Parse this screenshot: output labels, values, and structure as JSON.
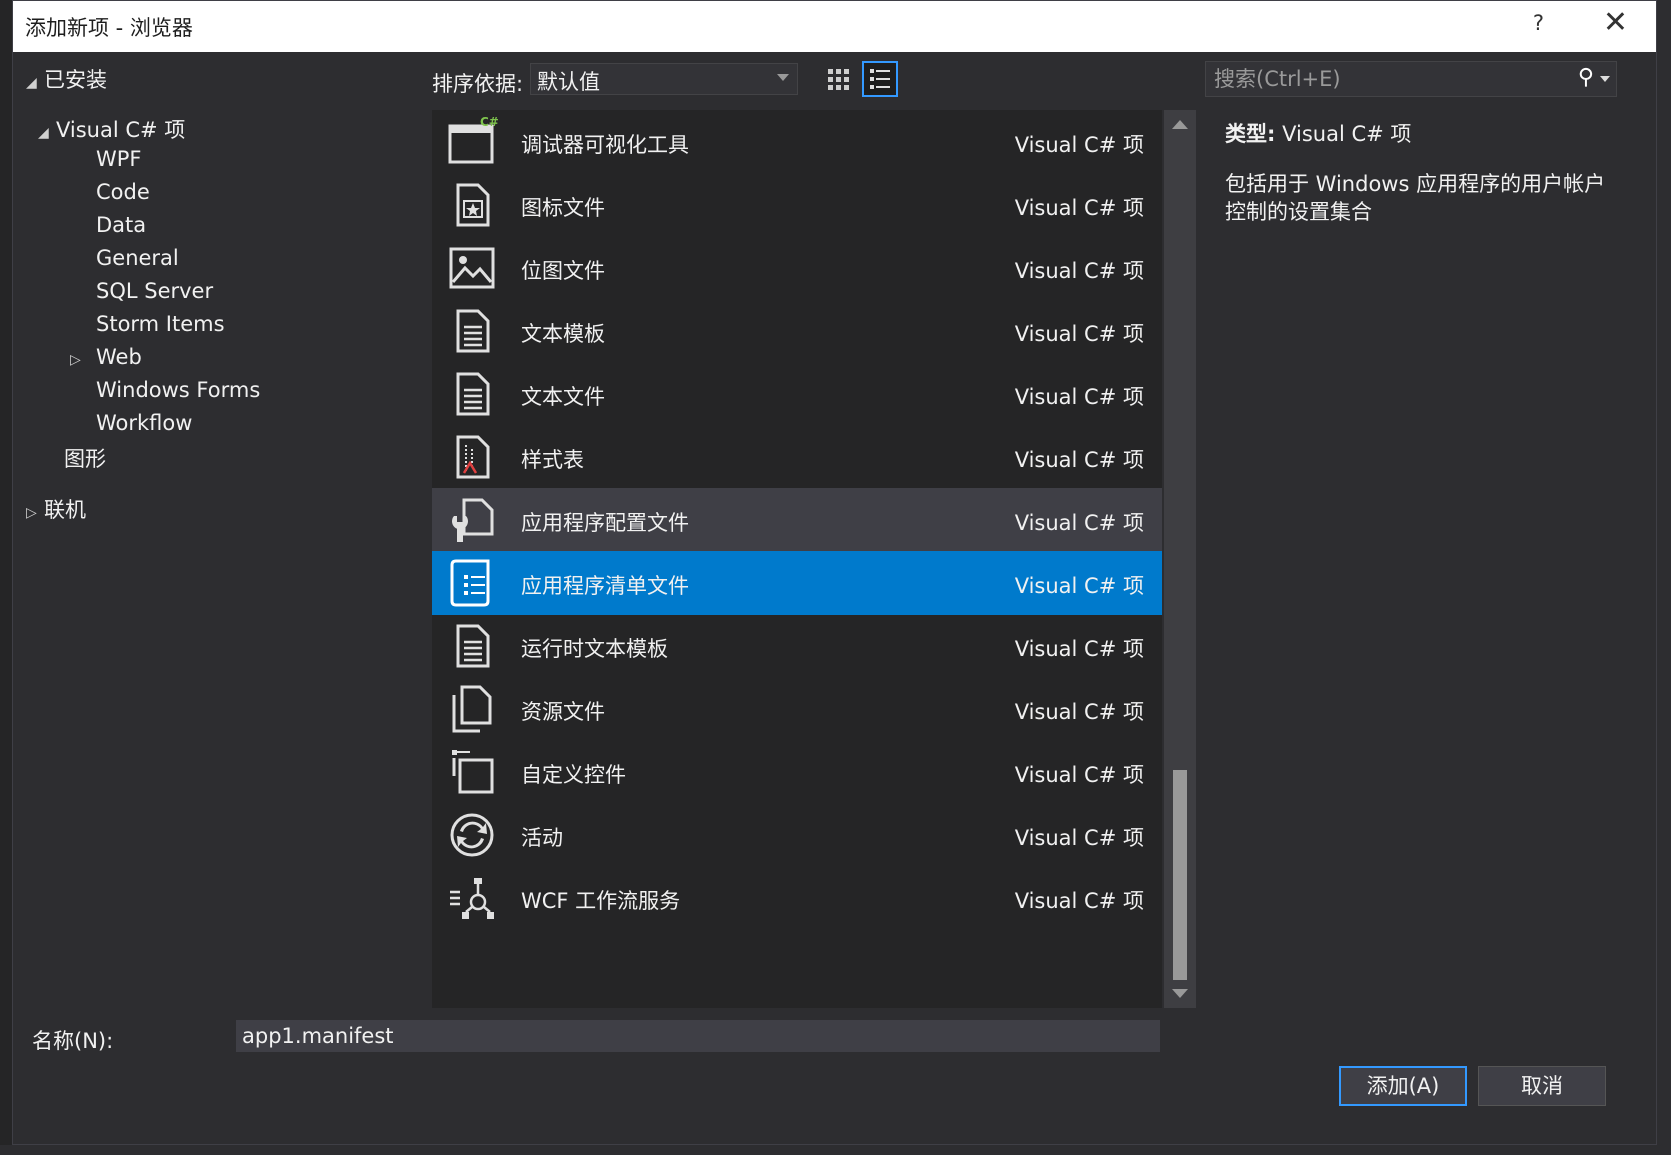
{
  "window": {
    "title": "添加新项 - 浏览器",
    "help": "?",
    "close": "✕"
  },
  "tree": {
    "installed": "已安装",
    "csharp": "Visual C# 项",
    "children": [
      "WPF",
      "Code",
      "Data",
      "General",
      "SQL Server",
      "Storm Items",
      "Web",
      "Windows Forms",
      "Workflow"
    ],
    "graphics": "图形",
    "online": "联机"
  },
  "toolbar": {
    "sort_label": "排序依据:",
    "sort_value": "默认值"
  },
  "search": {
    "placeholder": "搜索(Ctrl+E)"
  },
  "items": [
    {
      "name": "调试器可视化工具",
      "type": "Visual C# 项",
      "icon": "debugger-visualizer-icon"
    },
    {
      "name": "图标文件",
      "type": "Visual C# 项",
      "icon": "icon-file-icon"
    },
    {
      "name": "位图文件",
      "type": "Visual C# 项",
      "icon": "bitmap-icon"
    },
    {
      "name": "文本模板",
      "type": "Visual C# 项",
      "icon": "text-template-icon"
    },
    {
      "name": "文本文件",
      "type": "Visual C# 项",
      "icon": "text-file-icon"
    },
    {
      "name": "样式表",
      "type": "Visual C# 项",
      "icon": "stylesheet-icon"
    },
    {
      "name": "应用程序配置文件",
      "type": "Visual C# 项",
      "icon": "app-config-icon"
    },
    {
      "name": "应用程序清单文件",
      "type": "Visual C# 项",
      "icon": "app-manifest-icon"
    },
    {
      "name": "运行时文本模板",
      "type": "Visual C# 项",
      "icon": "runtime-template-icon"
    },
    {
      "name": "资源文件",
      "type": "Visual C# 项",
      "icon": "resource-file-icon"
    },
    {
      "name": "自定义控件",
      "type": "Visual C# 项",
      "icon": "custom-control-icon"
    },
    {
      "name": "活动",
      "type": "Visual C# 项",
      "icon": "activity-icon"
    },
    {
      "name": "WCF 工作流服务",
      "type": "Visual C# 项",
      "icon": "wcf-workflow-icon"
    }
  ],
  "details": {
    "type_label": "类型:",
    "type_value": "Visual C# 项",
    "description": "包括用于 Windows 应用程序的用户帐户控制的设置集合"
  },
  "footer": {
    "name_label": "名称(N):",
    "name_value": "app1.manifest",
    "add_button": "添加(A)",
    "cancel_button": "取消"
  },
  "colors": {
    "selected": "#007acc",
    "hover": "#3f3f46",
    "panel": "#252526",
    "dialog": "#2d2d30"
  }
}
